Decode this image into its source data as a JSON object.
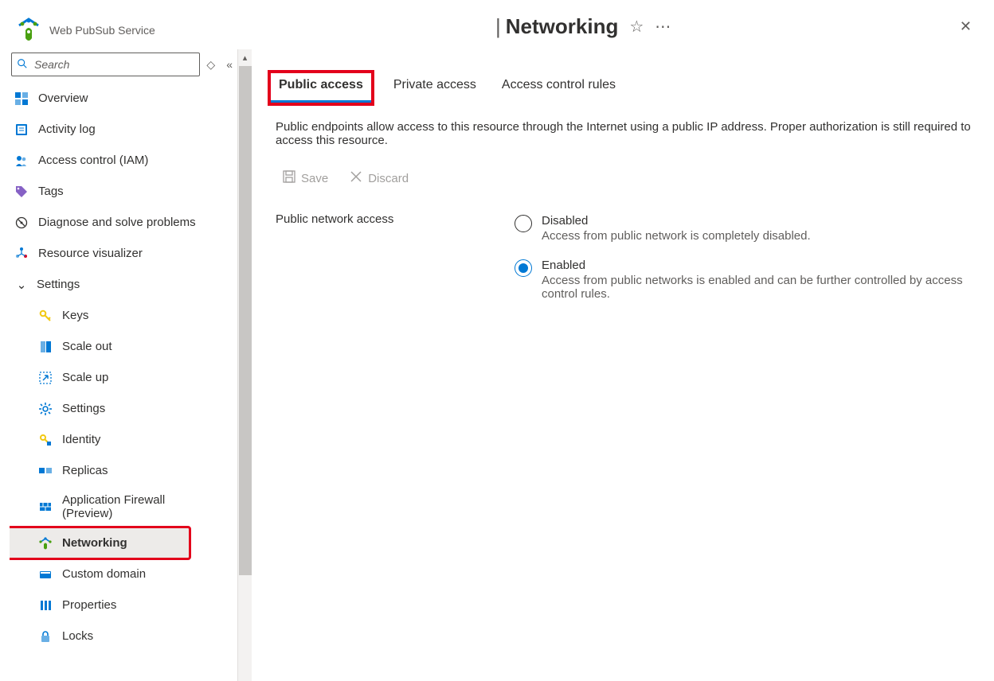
{
  "serviceName": "Web PubSub Service",
  "page": {
    "title": "Networking"
  },
  "search": {
    "placeholder": "Search"
  },
  "nav": {
    "overview": "Overview",
    "activityLog": "Activity log",
    "iam": "Access control (IAM)",
    "tags": "Tags",
    "diagnose": "Diagnose and solve problems",
    "visualizer": "Resource visualizer",
    "settingsGroup": "Settings",
    "keys": "Keys",
    "scaleOut": "Scale out",
    "scaleUp": "Scale up",
    "settings": "Settings",
    "identity": "Identity",
    "replicas": "Replicas",
    "appFirewall": "Application Firewall (Preview)",
    "networking": "Networking",
    "customDomain": "Custom domain",
    "properties": "Properties",
    "locks": "Locks"
  },
  "tabs": {
    "public": "Public access",
    "private": "Private access",
    "acl": "Access control rules"
  },
  "publicAccess": {
    "description": "Public endpoints allow access to this resource through the Internet using a public IP address. Proper authorization is still required to access this resource.",
    "save": "Save",
    "discard": "Discard",
    "fieldLabel": "Public network access",
    "options": {
      "disabled": {
        "title": "Disabled",
        "sub": "Access from public network is completely disabled."
      },
      "enabled": {
        "title": "Enabled",
        "sub": "Access from public networks is enabled and can be further controlled by access control rules."
      }
    },
    "selected": "enabled"
  }
}
